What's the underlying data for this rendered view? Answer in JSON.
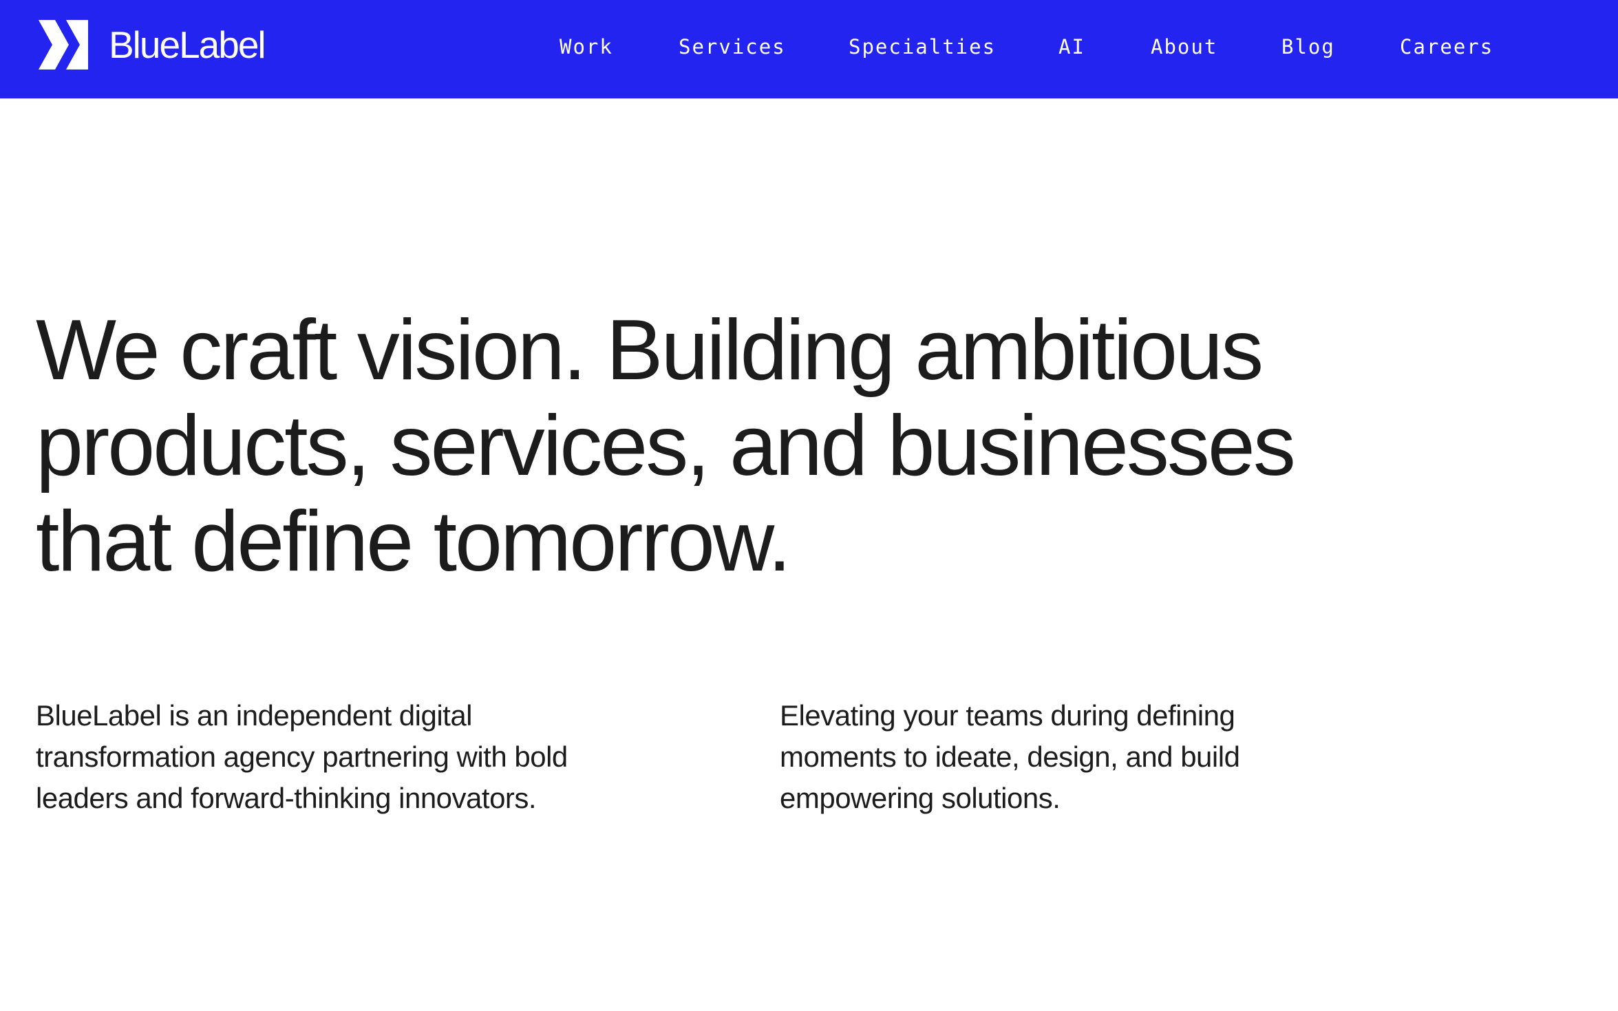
{
  "brand": {
    "name": "BlueLabel",
    "logo_icon": "bluelabel-chevron-logo-icon",
    "color_primary": "#2424f0",
    "color_text_on_primary": "#ffffff"
  },
  "nav": {
    "items": [
      {
        "label": "Work"
      },
      {
        "label": "Services"
      },
      {
        "label": "Specialties"
      },
      {
        "label": "AI"
      },
      {
        "label": "About"
      },
      {
        "label": "Blog"
      },
      {
        "label": "Careers"
      }
    ]
  },
  "hero": {
    "headline_lines": [
      "We craft vision. Building ambitious",
      "products, services, and businesses",
      "that define tomorrow."
    ]
  },
  "intro": {
    "left_lines": [
      "BlueLabel is an independent digital",
      "transformation agency partnering with bold",
      "leaders and forward-thinking innovators."
    ],
    "right_lines": [
      "Elevating your teams during defining",
      "moments to ideate, design, and build",
      "empowering solutions."
    ]
  }
}
